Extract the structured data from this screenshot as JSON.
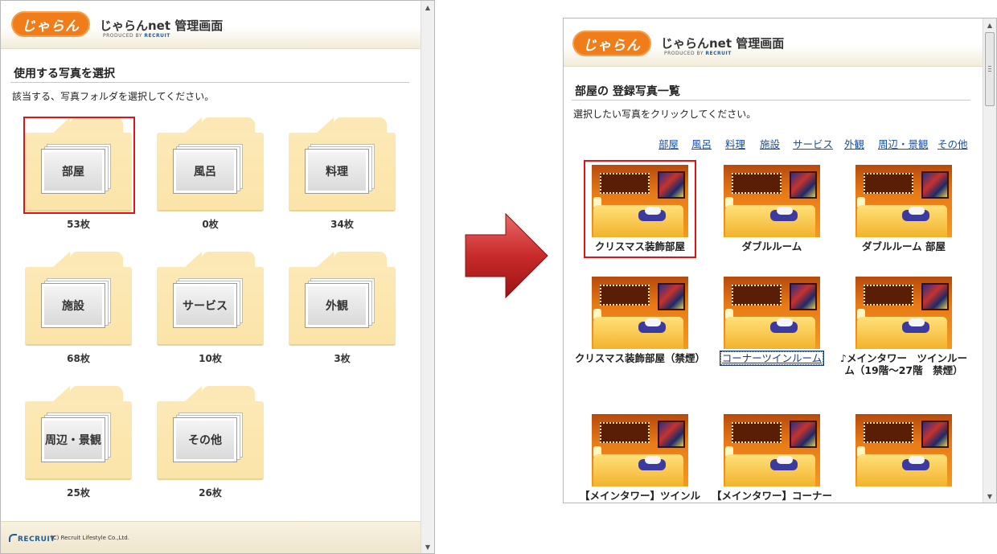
{
  "header": {
    "logo_text": "じゃらん",
    "title": "じゃらんnet 管理画面",
    "produced_by": "PRODUCED BY",
    "brand": "RECRUIT"
  },
  "left": {
    "title": "使用する写真を選択",
    "description": "該当する、写真フォルダを選択してください。",
    "folders": [
      {
        "label": "部屋",
        "count": "53枚",
        "selected": true
      },
      {
        "label": "風呂",
        "count": "0枚",
        "selected": false
      },
      {
        "label": "料理",
        "count": "34枚",
        "selected": false
      },
      {
        "label": "施設",
        "count": "68枚",
        "selected": false
      },
      {
        "label": "サービス",
        "count": "10枚",
        "selected": false
      },
      {
        "label": "外観",
        "count": "3枚",
        "selected": false
      },
      {
        "label": "周辺・景観",
        "count": "25枚",
        "selected": false
      },
      {
        "label": "その他",
        "count": "26枚",
        "selected": false
      }
    ],
    "footer": {
      "brand": "RECRUIT",
      "copyright": "(C) Recruit Lifestyle Co.,Ltd."
    }
  },
  "right": {
    "title": "部屋の 登録写真一覧",
    "description": "選択したい写真をクリックしてください。",
    "categories": [
      "部屋",
      "風呂",
      "料理",
      "施設",
      "サービス",
      "外観",
      "周辺・景観",
      "その他"
    ],
    "photos": [
      {
        "caption": "クリスマス装飾部屋",
        "selected": true
      },
      {
        "caption": "ダブルルーム",
        "selected": false
      },
      {
        "caption": "ダブルルーム 部屋",
        "selected": false
      },
      {
        "caption": "クリスマス装飾部屋（禁煙）",
        "selected": false
      },
      {
        "caption": "コーナーツインルーム",
        "selected": false,
        "focused": true
      },
      {
        "caption": "♪メインタワー　ツインルーム（19階～27階　禁煙）",
        "selected": false
      },
      {
        "caption": "【メインタワー】ツインル",
        "selected": false
      },
      {
        "caption": "【メインタワー】コーナー",
        "selected": false
      },
      {
        "caption": "",
        "selected": false
      }
    ]
  },
  "colors": {
    "accent_orange": "#f07d19",
    "selection_red": "#e01414",
    "link_blue": "#1a4ea3",
    "folder_yellow": "#fce9b6"
  }
}
